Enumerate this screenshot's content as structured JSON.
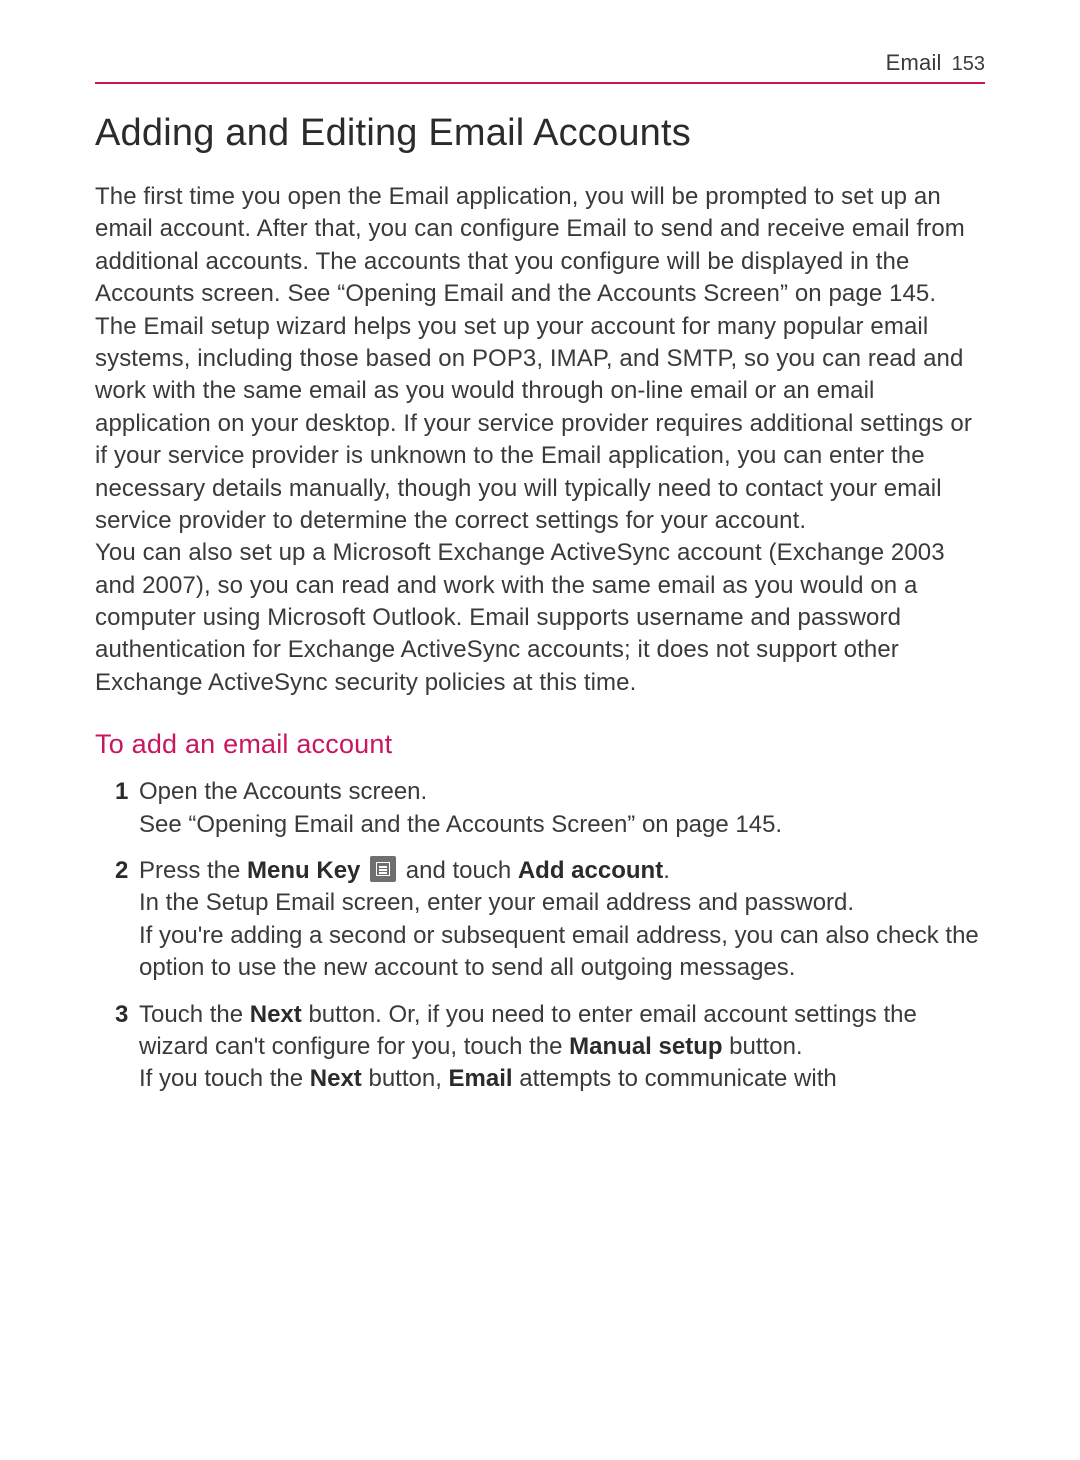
{
  "header": {
    "section": "Email",
    "page_number": "153"
  },
  "title": "Adding and Editing Email Accounts",
  "paragraphs": {
    "p1": "The first time you open the Email application, you will be prompted to set up an email account. After that, you can configure Email to send and receive email from additional accounts. The accounts that you configure will be displayed in the Accounts screen. See “Opening Email and the Accounts Screen” on page 145.",
    "p2": "The Email setup wizard helps you set up your account for many popular email systems, including those based on POP3, IMAP, and SMTP, so you can read and work with the same email as you would through on-line email or an email application on your desktop. If your service provider requires additional settings or if your service provider is unknown to the Email application, you can enter the necessary details manually, though you will typically need to contact your email service provider to determine the correct settings for your account.",
    "p3": "You can also set up a Microsoft Exchange ActiveSync account (Exchange 2003 and 2007), so you can read and work with the same email as you would on a computer using Microsoft Outlook. Email supports username and password authentication for Exchange ActiveSync accounts; it does not support other Exchange ActiveSync security policies at this time."
  },
  "subhead": "To add an email account",
  "steps": {
    "s1": {
      "num": "1",
      "line1": "Open the Accounts screen.",
      "line2": "See “Opening Email and the Accounts Screen” on page 145."
    },
    "s2": {
      "num": "2",
      "a": "Press the ",
      "menu_key": "Menu Key",
      "b": " and touch ",
      "add_account": "Add account",
      "c": ".",
      "line2": "In the Setup Email screen, enter your email address and password.",
      "line3": "If you're adding a second or subsequent email address, you can also check the option to use the new account to send all outgoing messages."
    },
    "s3": {
      "num": "3",
      "a": "Touch the ",
      "next": "Next",
      "b": " button. Or, if you need to enter email account settings the wizard can't configure for you, touch the ",
      "manual": "Manual setup",
      "c": " button.",
      "line2a": "If you touch the ",
      "line2next": "Next",
      "line2b": " button, ",
      "line2email": "Email",
      "line2c": " attempts to communicate with"
    }
  }
}
